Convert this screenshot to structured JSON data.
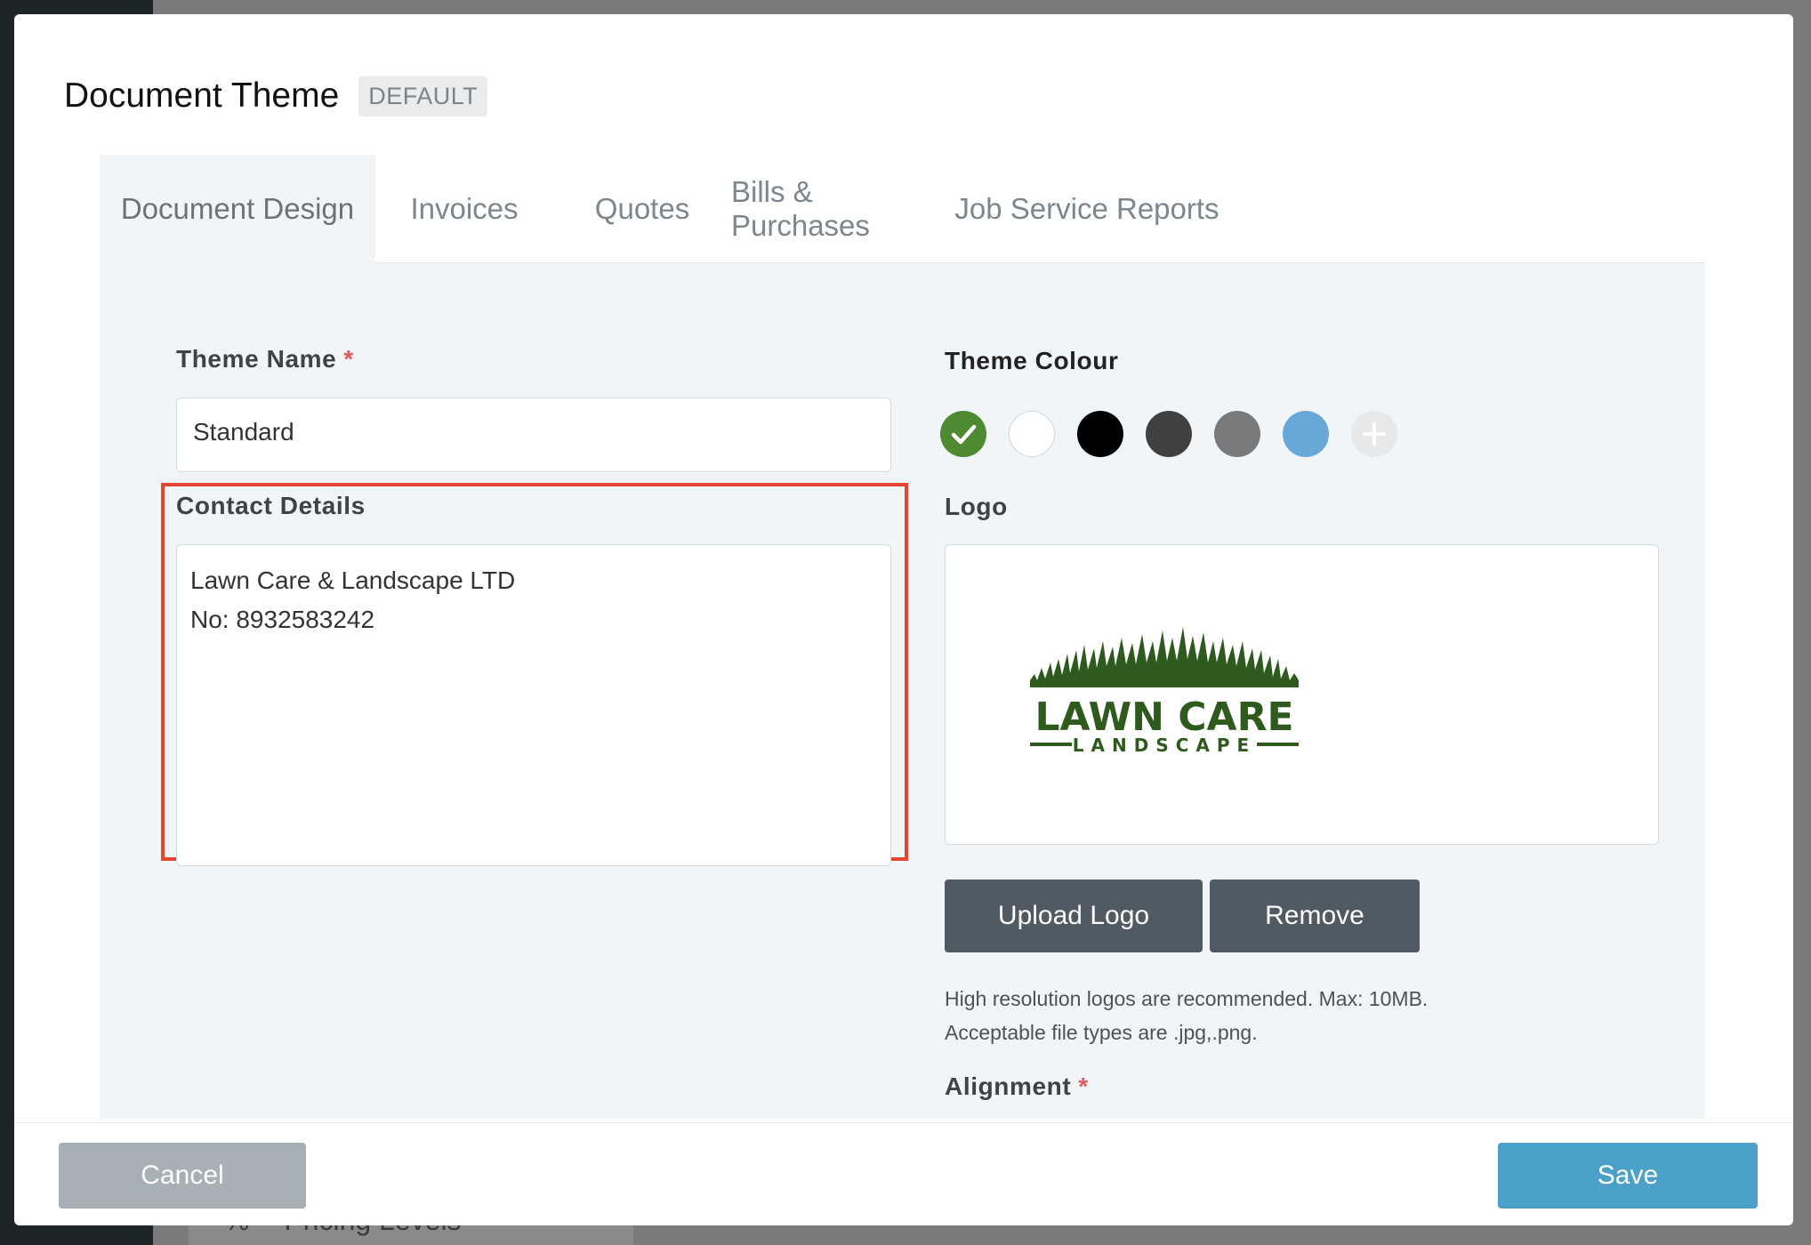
{
  "background": {
    "bottom_item_label": "Pricing Levels"
  },
  "modal": {
    "title": "Document Theme",
    "badge": "DEFAULT"
  },
  "tabs": [
    {
      "label": "Document Design",
      "active": true
    },
    {
      "label": "Invoices",
      "active": false
    },
    {
      "label": "Quotes",
      "active": false
    },
    {
      "label": "Bills & Purchases",
      "active": false
    },
    {
      "label": "Job Service Reports",
      "active": false
    }
  ],
  "form": {
    "theme_name_label": "Theme Name",
    "required_marker": "*",
    "theme_name_value": "Standard",
    "contact_details_label": "Contact Details",
    "contact_details_lines": [
      "Lawn Care & Landscape LTD",
      "No: 8932583242"
    ],
    "theme_colour_label": "Theme Colour",
    "swatches": [
      {
        "color": "#4e8a32",
        "selected": true,
        "icon": "check-icon"
      },
      {
        "color": "#ffffff",
        "selected": false
      },
      {
        "color": "#000000",
        "selected": false
      },
      {
        "color": "#404040",
        "selected": false
      },
      {
        "color": "#7a7a7a",
        "selected": false
      },
      {
        "color": "#68a8d8",
        "selected": false
      },
      {
        "color": "#e6e8ea",
        "selected": false,
        "icon": "plus-icon"
      }
    ],
    "logo_label": "Logo",
    "logo_text_main": "LAWN CARE",
    "logo_text_sub": "LANDSCAPE",
    "logo_color": "#2f5a1e",
    "upload_button": "Upload Logo",
    "remove_button": "Remove",
    "help_line_1": "High resolution logos are recommended. Max: 10MB.",
    "help_line_2": "Acceptable file types are .jpg,.png.",
    "alignment_label": "Alignment"
  },
  "footer": {
    "cancel": "Cancel",
    "save": "Save"
  }
}
